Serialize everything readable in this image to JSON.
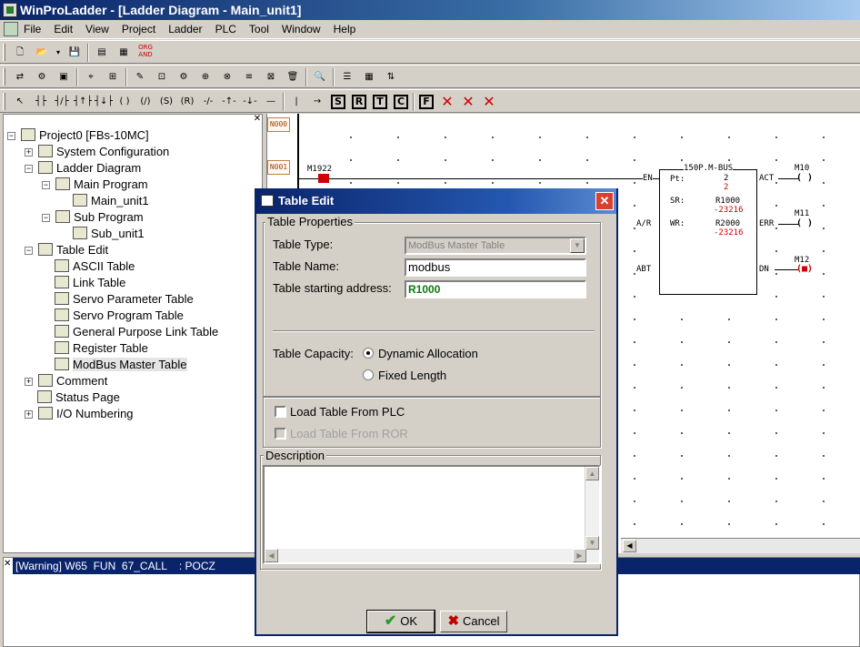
{
  "window": {
    "title": "WinProLadder - [Ladder Diagram - Main_unit1]"
  },
  "menu": [
    "File",
    "Edit",
    "View",
    "Project",
    "Ladder",
    "PLC",
    "Tool",
    "Window",
    "Help"
  ],
  "toolbar1": {
    "org_and_top": "ORG",
    "org_and_bottom": "AND"
  },
  "toolbar3": {
    "boxed": [
      "S",
      "R",
      "T",
      "C",
      "F"
    ]
  },
  "tree": {
    "root": "Project0 [FBs-10MC]",
    "items": [
      {
        "label": "System Configuration",
        "icon": "system-config-icon"
      },
      {
        "label": "Ladder Diagram",
        "icon": "ladder-icon"
      },
      {
        "label": "Main Program",
        "icon": "main-program-icon"
      },
      {
        "label": "Main_unit1",
        "icon": "unit-icon"
      },
      {
        "label": "Sub Program",
        "icon": "sub-program-icon"
      },
      {
        "label": "Sub_unit1",
        "icon": "unit-icon"
      },
      {
        "label": "Table Edit",
        "icon": "table-edit-icon"
      },
      {
        "label": "ASCII Table",
        "icon": "ascii-table-icon"
      },
      {
        "label": "Link Table",
        "icon": "link-table-icon"
      },
      {
        "label": "Servo Parameter Table",
        "icon": "servo-param-icon"
      },
      {
        "label": "Servo Program Table",
        "icon": "servo-program-icon"
      },
      {
        "label": "General Purpose Link Table",
        "icon": "gp-link-icon"
      },
      {
        "label": "Register Table",
        "icon": "register-table-icon"
      },
      {
        "label": "ModBus Master Table",
        "icon": "modbus-icon"
      },
      {
        "label": "Comment",
        "icon": "comment-icon"
      },
      {
        "label": "Status Page",
        "icon": "status-page-icon"
      },
      {
        "label": "I/O Numbering",
        "icon": "io-numbering-icon"
      }
    ]
  },
  "ladder": {
    "net0": "N000",
    "net1": "N001",
    "contact": "M1922",
    "fb_title": "150P.M-BUS",
    "pt_label": "Pt:",
    "pt_val1": "2",
    "pt_val2": "2",
    "sr_label": "SR:",
    "sr_val1": "R1000",
    "sr_val2": "-23216",
    "wr_label": "WR:",
    "wr_val1": "R2000",
    "wr_val2": "-23216",
    "en": "EN",
    "ar": "A/R",
    "abt": "ABT",
    "act": "ACT",
    "err": "ERR",
    "dn": "DN",
    "m10": "M10",
    "m11": "M11",
    "m12": "M12"
  },
  "output": {
    "message": "[Warning] W65  FUN  67_CALL    : POCZ"
  },
  "dialog": {
    "title": "Table Edit",
    "props_group": "Table Properties",
    "type_label": "Table Type:",
    "type_value": "ModBus Master Table",
    "name_label": "Table Name:",
    "name_value": "modbus",
    "addr_label": "Table starting address:",
    "addr_value": "R1000",
    "capacity_label": "Table Capacity:",
    "opt_dynamic": "Dynamic Allocation",
    "opt_fixed": "Fixed Length",
    "load_plc": "Load Table From PLC",
    "load_ror": "Load Table From ROR",
    "desc_group": "Description",
    "ok": "OK",
    "cancel": "Cancel"
  }
}
